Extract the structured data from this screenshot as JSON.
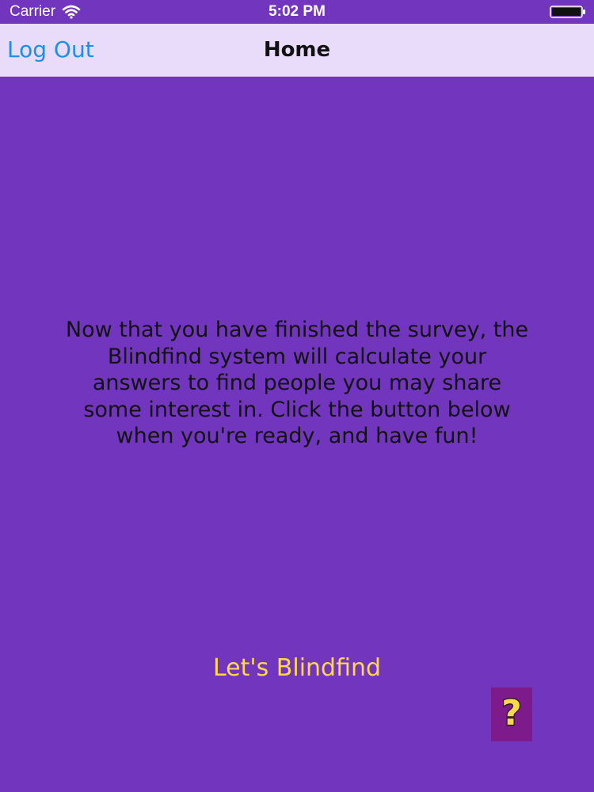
{
  "status_bar": {
    "carrier": "Carrier",
    "time": "5:02 PM",
    "wifi_icon": "wifi-icon",
    "battery_icon": "battery-icon",
    "text_color": "#ffffff"
  },
  "nav": {
    "back_label": "Log Out",
    "title": "Home",
    "back_color": "#1f8ee8",
    "background": "#e8dcfa"
  },
  "main": {
    "message": "Now that you have finished the survey, the Blindfind system will calculate your answers to find people you may share some interest in. Click the button below when you're ready, and have fun!",
    "cta_label": "Let's Blindfind",
    "cta_color": "#ffd84a",
    "help_icon": "question-mark-icon",
    "background": "#7235bd"
  }
}
